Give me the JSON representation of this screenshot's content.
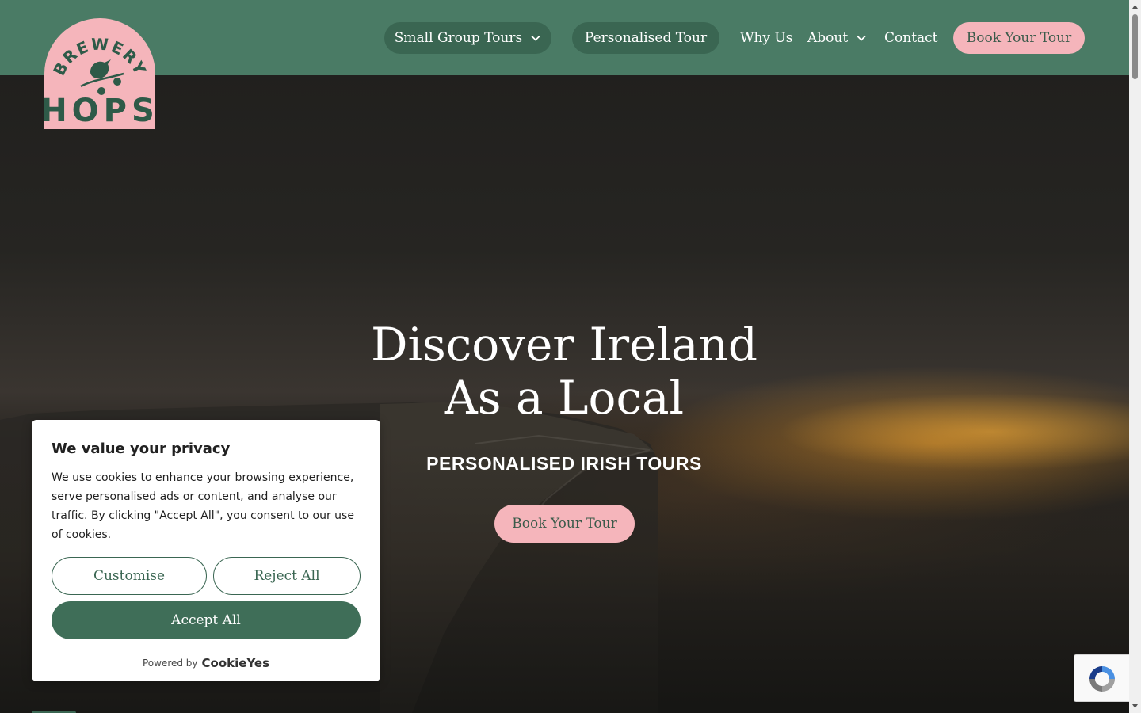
{
  "brand": {
    "logo_text_top": "BREWERY",
    "logo_text_bottom": "HOPS",
    "pink": "#f5b5bb",
    "green": "#4a7b65",
    "dark_green": "#3a6652"
  },
  "nav": {
    "small_group_tours": "Small Group Tours",
    "personalised_tour": "Personalised Tour",
    "why_us": "Why Us",
    "about": "About",
    "contact": "Contact",
    "book_your_tour": "Book Your Tour"
  },
  "hero": {
    "title_line1": "Discover Ireland",
    "title_line2": "As a Local",
    "subtitle": "PERSONALISED IRISH TOURS",
    "cta": "Book Your Tour"
  },
  "cookie": {
    "title": "We value your privacy",
    "body": "We use cookies to enhance your browsing experience, serve personalised ads or content, and analyse our traffic. By clicking \"Accept All\", you consent to our use of cookies.",
    "customise": "Customise",
    "reject_all": "Reject All",
    "accept_all": "Accept All",
    "powered_by": "Powered by",
    "powered_brand": "CookieYes"
  },
  "icons": {
    "chevron": "chevron-down-icon",
    "recaptcha": "recaptcha-icon"
  }
}
